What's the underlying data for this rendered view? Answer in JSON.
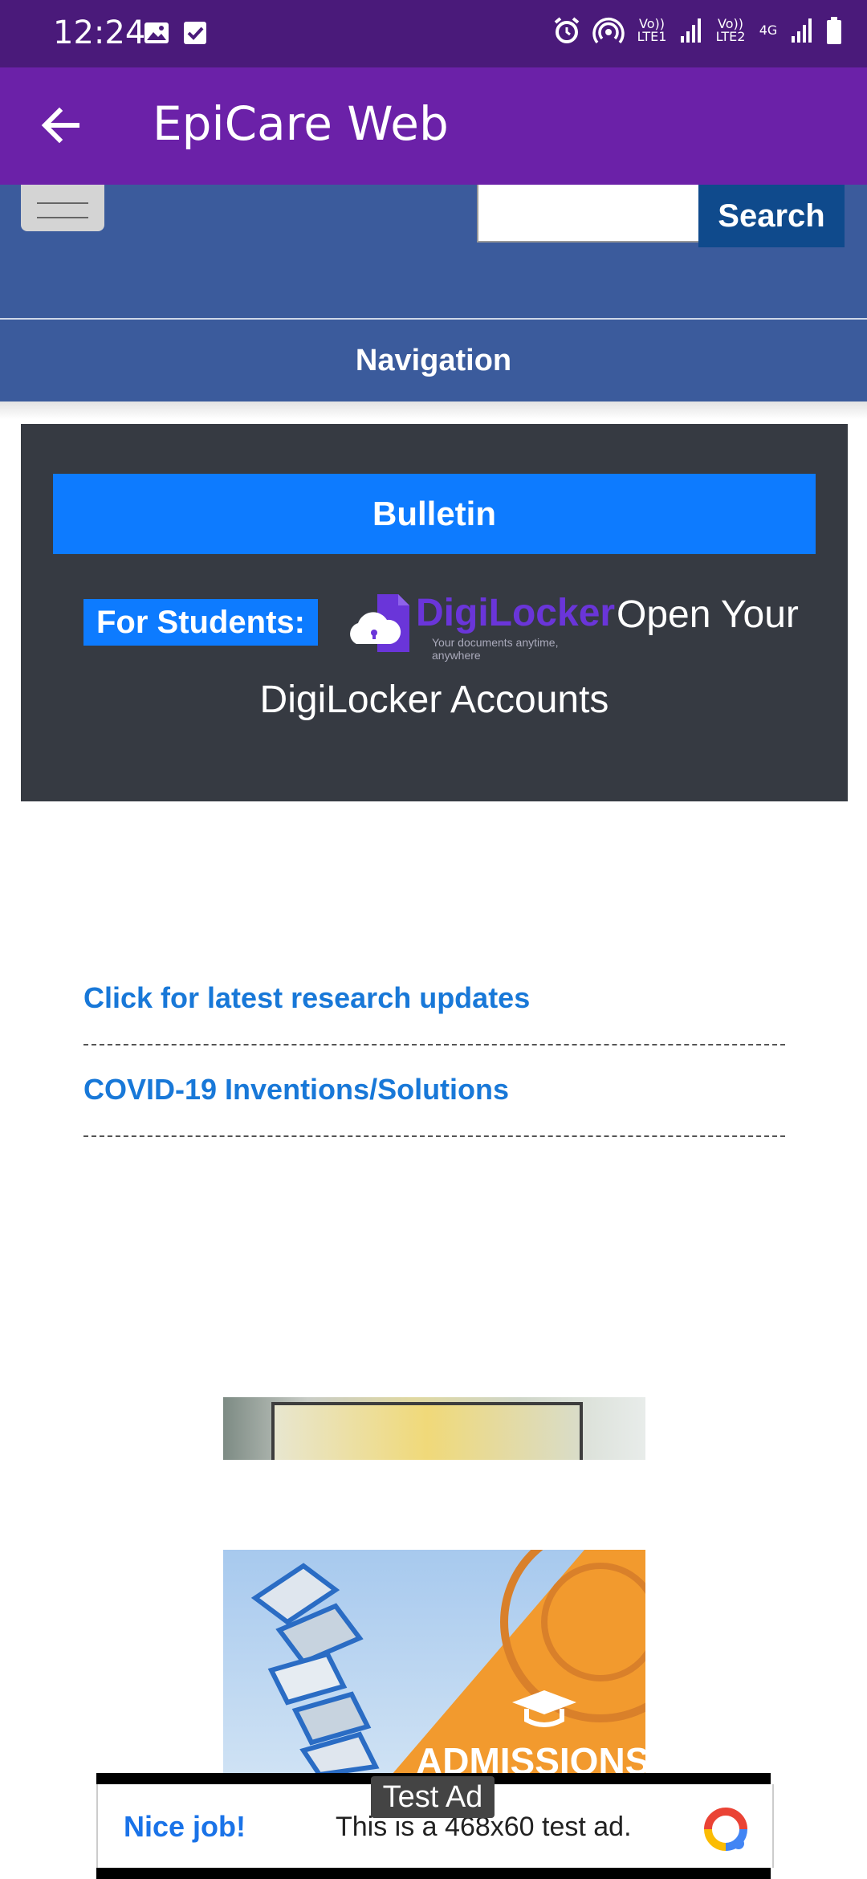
{
  "status_bar": {
    "time": "12:24",
    "sim1_label": "Vo)) LTE1",
    "sim2_label": "Vo)) LTE2",
    "network": "4G"
  },
  "app_bar": {
    "title": "EpiCare Web"
  },
  "web_header": {
    "search_button": "Search",
    "search_placeholder": ""
  },
  "navigation": {
    "label": "Navigation"
  },
  "bulletin": {
    "heading": "Bulletin",
    "students_label": "For Students:",
    "digilocker_name": "DigiLocker",
    "digilocker_tagline": "Your documents anytime, anywhere",
    "open_text": "Open Your",
    "accounts_text": "DigiLocker Accounts"
  },
  "links": [
    {
      "label": "Click for latest research updates"
    },
    {
      "label": "COVID-19 Inventions/Solutions"
    }
  ],
  "banner": {
    "text": "ADMISSIONS"
  },
  "ad": {
    "badge": "Test Ad",
    "headline": "Nice job!",
    "body": "This is a 468x60 test ad."
  },
  "colors": {
    "status_bar": "#4a1a7a",
    "app_bar": "#6b21a8",
    "header_blue": "#3b5b9c",
    "search_button": "#0f4a8c",
    "bulletin_bg": "#363a42",
    "accent_blue": "#0d7bff",
    "link_blue": "#1878d8"
  }
}
